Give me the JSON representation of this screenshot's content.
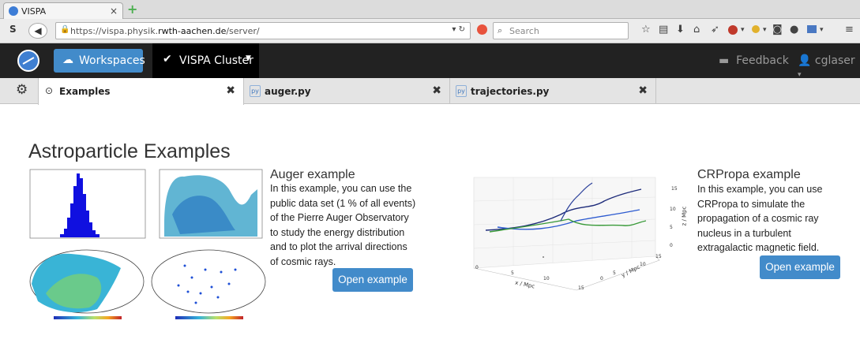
{
  "browser": {
    "tab_title": "VISPA",
    "tab_close": "×",
    "new_tab": "+",
    "url_prefix": "https://vispa.physik.",
    "url_domain": "rwth-aachen.de",
    "url_suffix": "/server/",
    "search_placeholder": "Search",
    "url_reload": "↻",
    "url_dropdown": "▾",
    "toolbar_icons": [
      "star-icon",
      "clipboard-icon",
      "download-icon",
      "home-icon",
      "send-icon",
      "adblock-icon",
      "addon-icon",
      "pocket-icon",
      "chat-icon",
      "screen-icon",
      "menu-icon"
    ]
  },
  "header": {
    "workspaces_label": "Workspaces",
    "cluster_label": "VISPA Cluster",
    "feedback_label": "Feedback",
    "user_label": "cglaser"
  },
  "tabs": [
    {
      "label": "Examples",
      "icon": "clock-icon",
      "active": true
    },
    {
      "label": "auger.py",
      "icon": "python-file-icon",
      "active": false
    },
    {
      "label": "trajectories.py",
      "icon": "python-file-icon",
      "active": false
    }
  ],
  "page_title": "Astroparticle Examples",
  "examples": [
    {
      "title": "Auger example",
      "description_lines": [
        "In this example, you can use the",
        "public data set (1 % of all events)",
        "of the Pierre Auger Observatory",
        "to study the energy distribution",
        "and to plot the arrival directions",
        "of cosmic rays."
      ],
      "button": "Open example"
    },
    {
      "title": "CRPropa example",
      "description_lines": [
        "In this example, you can use",
        "CRPropa to simulate the",
        "propagation of a cosmic ray",
        "nucleus in a turbulent",
        "extragalactic magnetic field."
      ],
      "button": "Open example"
    }
  ],
  "colors": {
    "accent": "#428bca",
    "header": "#222222"
  }
}
